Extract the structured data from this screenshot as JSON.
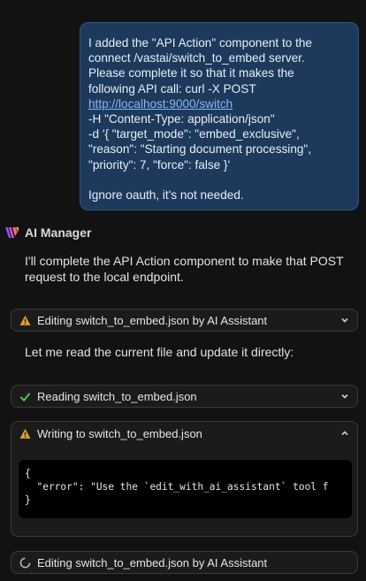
{
  "user_message": {
    "para1_lines": [
      "I added the \"API Action\" component to the",
      "connect /vastai/switch_to_embed server.",
      "Please complete it so that it makes the",
      "following API call: curl -X POST"
    ],
    "link": "http://localhost:9000/switch",
    "para1_rest": [
      "-H \"Content-Type: application/json\"",
      "-d '{ \"target_mode\": \"embed_exclusive\",",
      "\"reason\": \"Starting document processing\",",
      "\"priority\": 7, \"force\": false }'"
    ],
    "para2": "Ignore oauth, it's not needed."
  },
  "assistant": {
    "name": "AI Manager",
    "logo_icon": "ai-manager-logo",
    "reply1": "I'll complete the API Action component to make that POST request to the local endpoint.",
    "reply2": "Let me read the current file and update it directly:"
  },
  "tools": {
    "t1": {
      "label": "Editing switch_to_embed.json by AI Assistant",
      "status": "warning",
      "icon": "warning-icon"
    },
    "t2": {
      "label": "Reading switch_to_embed.json",
      "status": "success",
      "icon": "check-icon"
    },
    "t3": {
      "label": "Writing to switch_to_embed.json",
      "status": "warning",
      "icon": "warning-icon",
      "expanded": true,
      "code_lines": [
        "{",
        "  \"error\": \"Use the `edit_with_ai_assistant` tool f",
        "}"
      ]
    },
    "t4": {
      "label": "Editing switch_to_embed.json by AI Assistant",
      "status": "in-progress",
      "icon": "spinner-icon"
    }
  },
  "colors": {
    "warning": "#e0a12b",
    "success": "#5fb85a",
    "link": "#8ab4f8",
    "bubble": "#1d3a5c"
  }
}
